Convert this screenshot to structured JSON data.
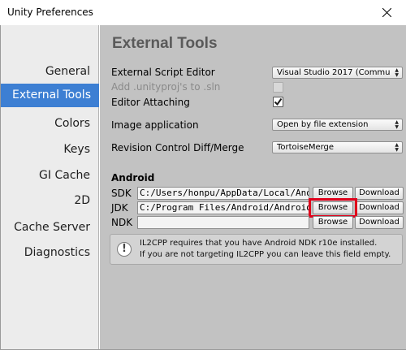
{
  "window": {
    "title": "Unity Preferences"
  },
  "sidebar": {
    "items": [
      {
        "label": "General",
        "selected": false
      },
      {
        "label": "External Tools",
        "selected": true
      },
      {
        "label": "Colors",
        "selected": false
      },
      {
        "label": "Keys",
        "selected": false
      },
      {
        "label": "GI Cache",
        "selected": false
      },
      {
        "label": "2D",
        "selected": false
      },
      {
        "label": "Cache Server",
        "selected": false
      },
      {
        "label": "Diagnostics",
        "selected": false
      }
    ]
  },
  "main": {
    "heading": "External Tools",
    "external_script_editor": {
      "label": "External Script Editor",
      "value": "Visual Studio 2017 (Commu"
    },
    "add_unityproj": {
      "label": "Add .unityproj's to .sln",
      "checked": false,
      "enabled": false
    },
    "editor_attaching": {
      "label": "Editor Attaching",
      "checked": true
    },
    "image_application": {
      "label": "Image application",
      "value": "Open by file extension"
    },
    "revision_control": {
      "label": "Revision Control Diff/Merge",
      "value": "TortoiseMerge"
    },
    "android": {
      "section_label": "Android",
      "sdk": {
        "label": "SDK",
        "path": "C:/Users/honpu/AppData/Local/Andr"
      },
      "jdk": {
        "label": "JDK",
        "path": "C:/Program Files/Android/Android S"
      },
      "ndk": {
        "label": "NDK",
        "path": ""
      },
      "browse_label": "Browse",
      "download_label": "Download"
    },
    "help": {
      "line1": "IL2CPP requires that you have Android NDK r10e installed.",
      "line2": "If you are not targeting IL2CPP you can leave this field empty."
    }
  },
  "colors": {
    "selection": "#3d7fd3",
    "highlight_box": "#e0001b",
    "content_bg": "#c2c2c2"
  }
}
